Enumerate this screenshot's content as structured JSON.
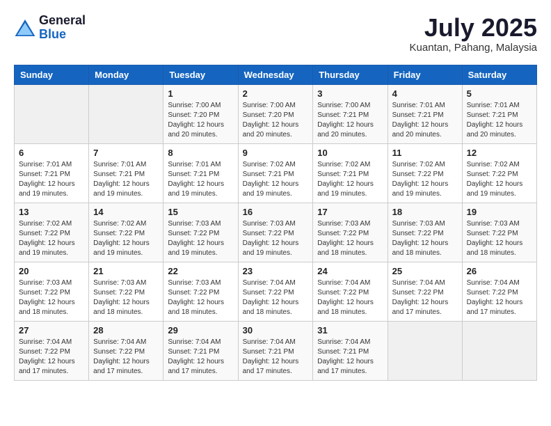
{
  "logo": {
    "text_general": "General",
    "text_blue": "Blue"
  },
  "title": {
    "month_year": "July 2025",
    "location": "Kuantan, Pahang, Malaysia"
  },
  "days_of_week": [
    "Sunday",
    "Monday",
    "Tuesday",
    "Wednesday",
    "Thursday",
    "Friday",
    "Saturday"
  ],
  "weeks": [
    [
      {
        "day": "",
        "info": ""
      },
      {
        "day": "",
        "info": ""
      },
      {
        "day": "1",
        "info": "Sunrise: 7:00 AM\nSunset: 7:20 PM\nDaylight: 12 hours and 20 minutes."
      },
      {
        "day": "2",
        "info": "Sunrise: 7:00 AM\nSunset: 7:20 PM\nDaylight: 12 hours and 20 minutes."
      },
      {
        "day": "3",
        "info": "Sunrise: 7:00 AM\nSunset: 7:21 PM\nDaylight: 12 hours and 20 minutes."
      },
      {
        "day": "4",
        "info": "Sunrise: 7:01 AM\nSunset: 7:21 PM\nDaylight: 12 hours and 20 minutes."
      },
      {
        "day": "5",
        "info": "Sunrise: 7:01 AM\nSunset: 7:21 PM\nDaylight: 12 hours and 20 minutes."
      }
    ],
    [
      {
        "day": "6",
        "info": "Sunrise: 7:01 AM\nSunset: 7:21 PM\nDaylight: 12 hours and 19 minutes."
      },
      {
        "day": "7",
        "info": "Sunrise: 7:01 AM\nSunset: 7:21 PM\nDaylight: 12 hours and 19 minutes."
      },
      {
        "day": "8",
        "info": "Sunrise: 7:01 AM\nSunset: 7:21 PM\nDaylight: 12 hours and 19 minutes."
      },
      {
        "day": "9",
        "info": "Sunrise: 7:02 AM\nSunset: 7:21 PM\nDaylight: 12 hours and 19 minutes."
      },
      {
        "day": "10",
        "info": "Sunrise: 7:02 AM\nSunset: 7:21 PM\nDaylight: 12 hours and 19 minutes."
      },
      {
        "day": "11",
        "info": "Sunrise: 7:02 AM\nSunset: 7:22 PM\nDaylight: 12 hours and 19 minutes."
      },
      {
        "day": "12",
        "info": "Sunrise: 7:02 AM\nSunset: 7:22 PM\nDaylight: 12 hours and 19 minutes."
      }
    ],
    [
      {
        "day": "13",
        "info": "Sunrise: 7:02 AM\nSunset: 7:22 PM\nDaylight: 12 hours and 19 minutes."
      },
      {
        "day": "14",
        "info": "Sunrise: 7:02 AM\nSunset: 7:22 PM\nDaylight: 12 hours and 19 minutes."
      },
      {
        "day": "15",
        "info": "Sunrise: 7:03 AM\nSunset: 7:22 PM\nDaylight: 12 hours and 19 minutes."
      },
      {
        "day": "16",
        "info": "Sunrise: 7:03 AM\nSunset: 7:22 PM\nDaylight: 12 hours and 19 minutes."
      },
      {
        "day": "17",
        "info": "Sunrise: 7:03 AM\nSunset: 7:22 PM\nDaylight: 12 hours and 18 minutes."
      },
      {
        "day": "18",
        "info": "Sunrise: 7:03 AM\nSunset: 7:22 PM\nDaylight: 12 hours and 18 minutes."
      },
      {
        "day": "19",
        "info": "Sunrise: 7:03 AM\nSunset: 7:22 PM\nDaylight: 12 hours and 18 minutes."
      }
    ],
    [
      {
        "day": "20",
        "info": "Sunrise: 7:03 AM\nSunset: 7:22 PM\nDaylight: 12 hours and 18 minutes."
      },
      {
        "day": "21",
        "info": "Sunrise: 7:03 AM\nSunset: 7:22 PM\nDaylight: 12 hours and 18 minutes."
      },
      {
        "day": "22",
        "info": "Sunrise: 7:03 AM\nSunset: 7:22 PM\nDaylight: 12 hours and 18 minutes."
      },
      {
        "day": "23",
        "info": "Sunrise: 7:04 AM\nSunset: 7:22 PM\nDaylight: 12 hours and 18 minutes."
      },
      {
        "day": "24",
        "info": "Sunrise: 7:04 AM\nSunset: 7:22 PM\nDaylight: 12 hours and 18 minutes."
      },
      {
        "day": "25",
        "info": "Sunrise: 7:04 AM\nSunset: 7:22 PM\nDaylight: 12 hours and 17 minutes."
      },
      {
        "day": "26",
        "info": "Sunrise: 7:04 AM\nSunset: 7:22 PM\nDaylight: 12 hours and 17 minutes."
      }
    ],
    [
      {
        "day": "27",
        "info": "Sunrise: 7:04 AM\nSunset: 7:22 PM\nDaylight: 12 hours and 17 minutes."
      },
      {
        "day": "28",
        "info": "Sunrise: 7:04 AM\nSunset: 7:22 PM\nDaylight: 12 hours and 17 minutes."
      },
      {
        "day": "29",
        "info": "Sunrise: 7:04 AM\nSunset: 7:21 PM\nDaylight: 12 hours and 17 minutes."
      },
      {
        "day": "30",
        "info": "Sunrise: 7:04 AM\nSunset: 7:21 PM\nDaylight: 12 hours and 17 minutes."
      },
      {
        "day": "31",
        "info": "Sunrise: 7:04 AM\nSunset: 7:21 PM\nDaylight: 12 hours and 17 minutes."
      },
      {
        "day": "",
        "info": ""
      },
      {
        "day": "",
        "info": ""
      }
    ]
  ]
}
